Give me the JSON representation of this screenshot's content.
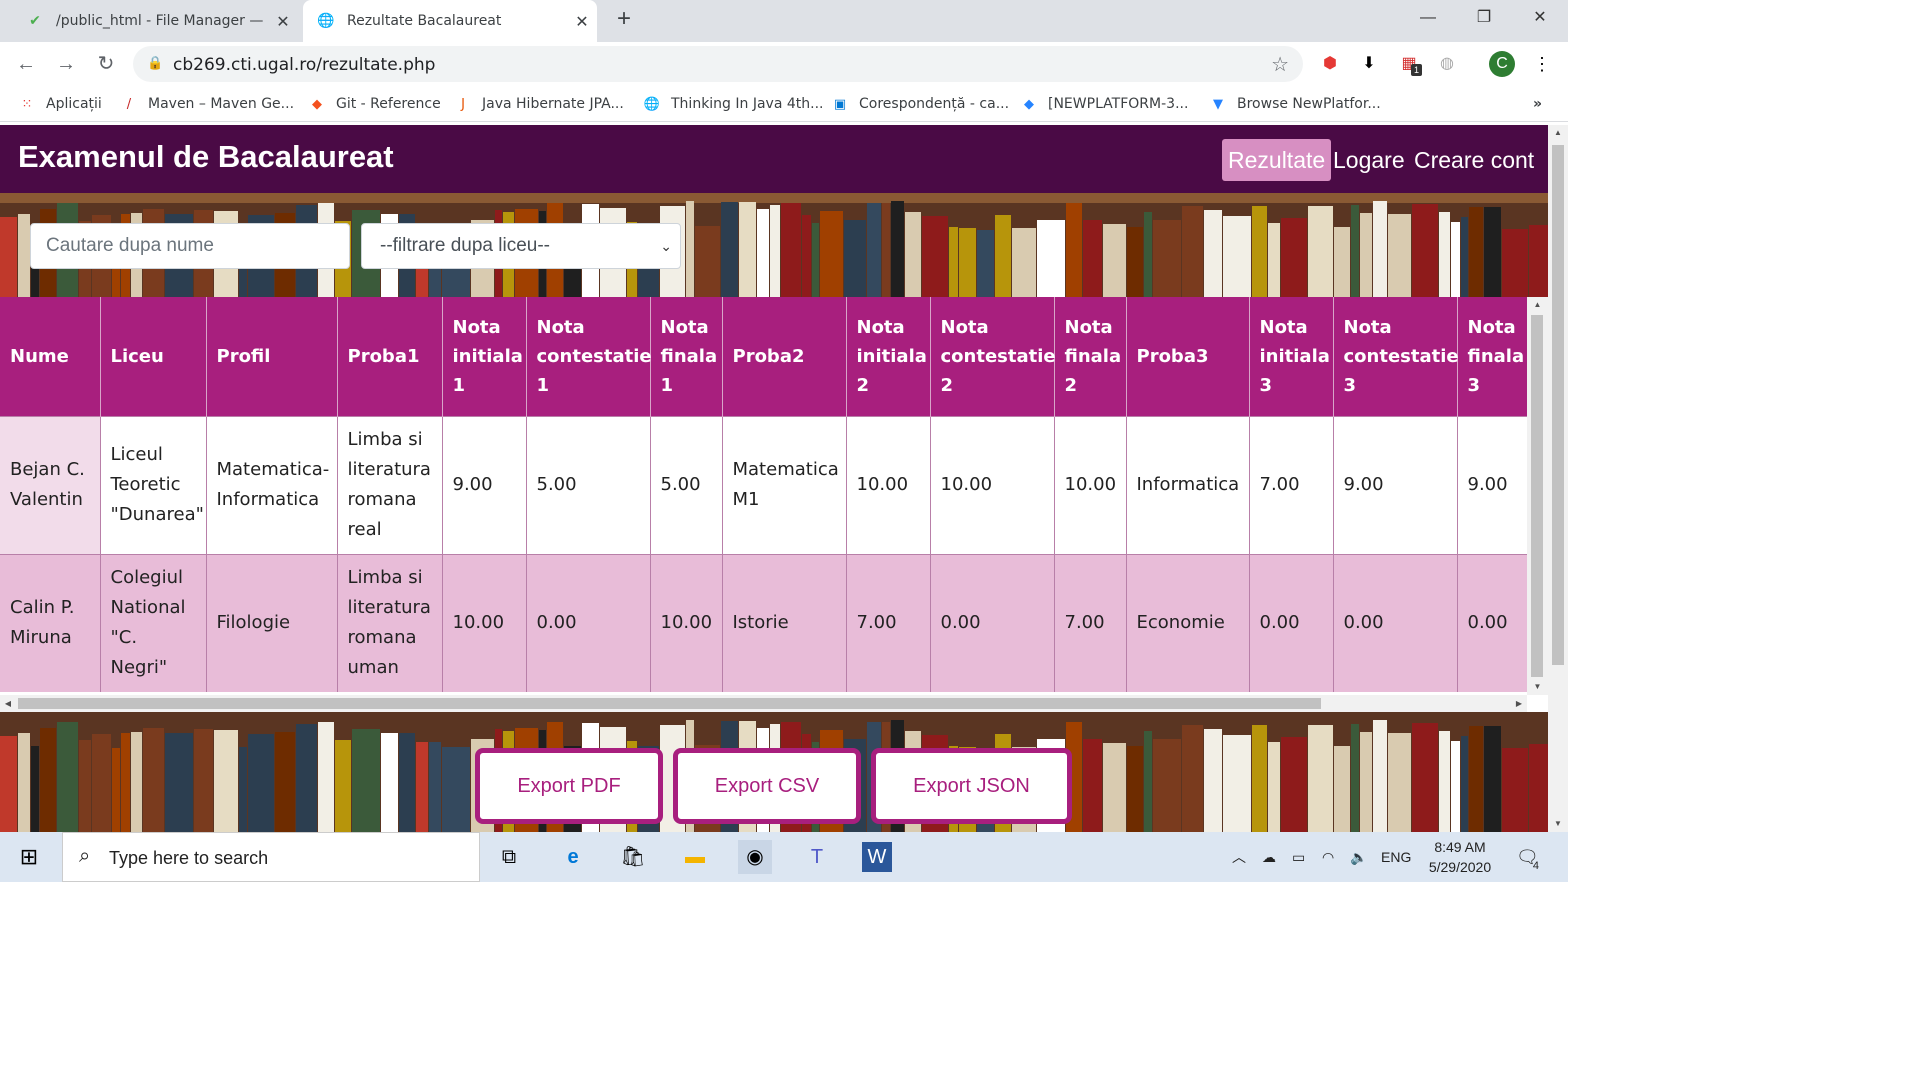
{
  "browser": {
    "tabs": [
      {
        "title": "/public_html - File Manager — W",
        "icon": "check-icon"
      },
      {
        "title": "Rezultate Bacalaureat",
        "icon": "globe-icon"
      }
    ],
    "url": "cb269.cti.ugal.ro/rezultate.php",
    "profile_initial": "C",
    "ext_badge": "1",
    "bookmarks": [
      "Aplicații",
      "Maven – Maven Ge...",
      "Git - Reference",
      "Java Hibernate JPA...",
      "Thinking In Java 4th...",
      "Corespondență - ca...",
      "[NEWPLATFORM-3...",
      "Browse NewPlatfor..."
    ]
  },
  "header": {
    "brand": "Examenul de Bacalaureat",
    "nav": [
      "Rezultate",
      "Logare",
      "Creare cont"
    ]
  },
  "filters": {
    "search_placeholder": "Cautare dupa nume",
    "select_value": "--filtrare dupa liceu--"
  },
  "table": {
    "columns": [
      "Nume",
      "Liceu",
      "Profil",
      "Proba1",
      "Nota initiala 1",
      "Nota contestatie 1",
      "Nota finala 1",
      "Proba2",
      "Nota initiala 2",
      "Nota contestatie 2",
      "Nota finala 2",
      "Proba3",
      "Nota initiala 3",
      "Nota contestatie 3",
      "Nota finala 3"
    ],
    "rows": [
      [
        "Bejan C. Valentin",
        "Liceul Teoretic \"Dunarea\"",
        "Matematica-Informatica",
        "Limba si literatura romana real",
        "9.00",
        "5.00",
        "5.00",
        "Matematica M1",
        "10.00",
        "10.00",
        "10.00",
        "Informatica",
        "7.00",
        "9.00",
        "9.00"
      ],
      [
        "Calin P. Miruna",
        "Colegiul National \"C. Negri\"",
        "Filologie",
        "Limba si literatura romana uman",
        "10.00",
        "0.00",
        "10.00",
        "Istorie",
        "7.00",
        "0.00",
        "7.00",
        "Economie",
        "0.00",
        "0.00",
        "0.00"
      ]
    ]
  },
  "buttons": {
    "export_pdf": "Export PDF",
    "export_csv": "Export CSV",
    "export_json": "Export JSON"
  },
  "taskbar": {
    "search_placeholder": "Type here to search",
    "lang": "ENG",
    "time": "8:49 AM",
    "date": "5/29/2020",
    "notifications": "4"
  },
  "colors": {
    "header_bg": "#4a0a45",
    "accent": "#a81f7e",
    "active_nav": "#d78fc2"
  }
}
